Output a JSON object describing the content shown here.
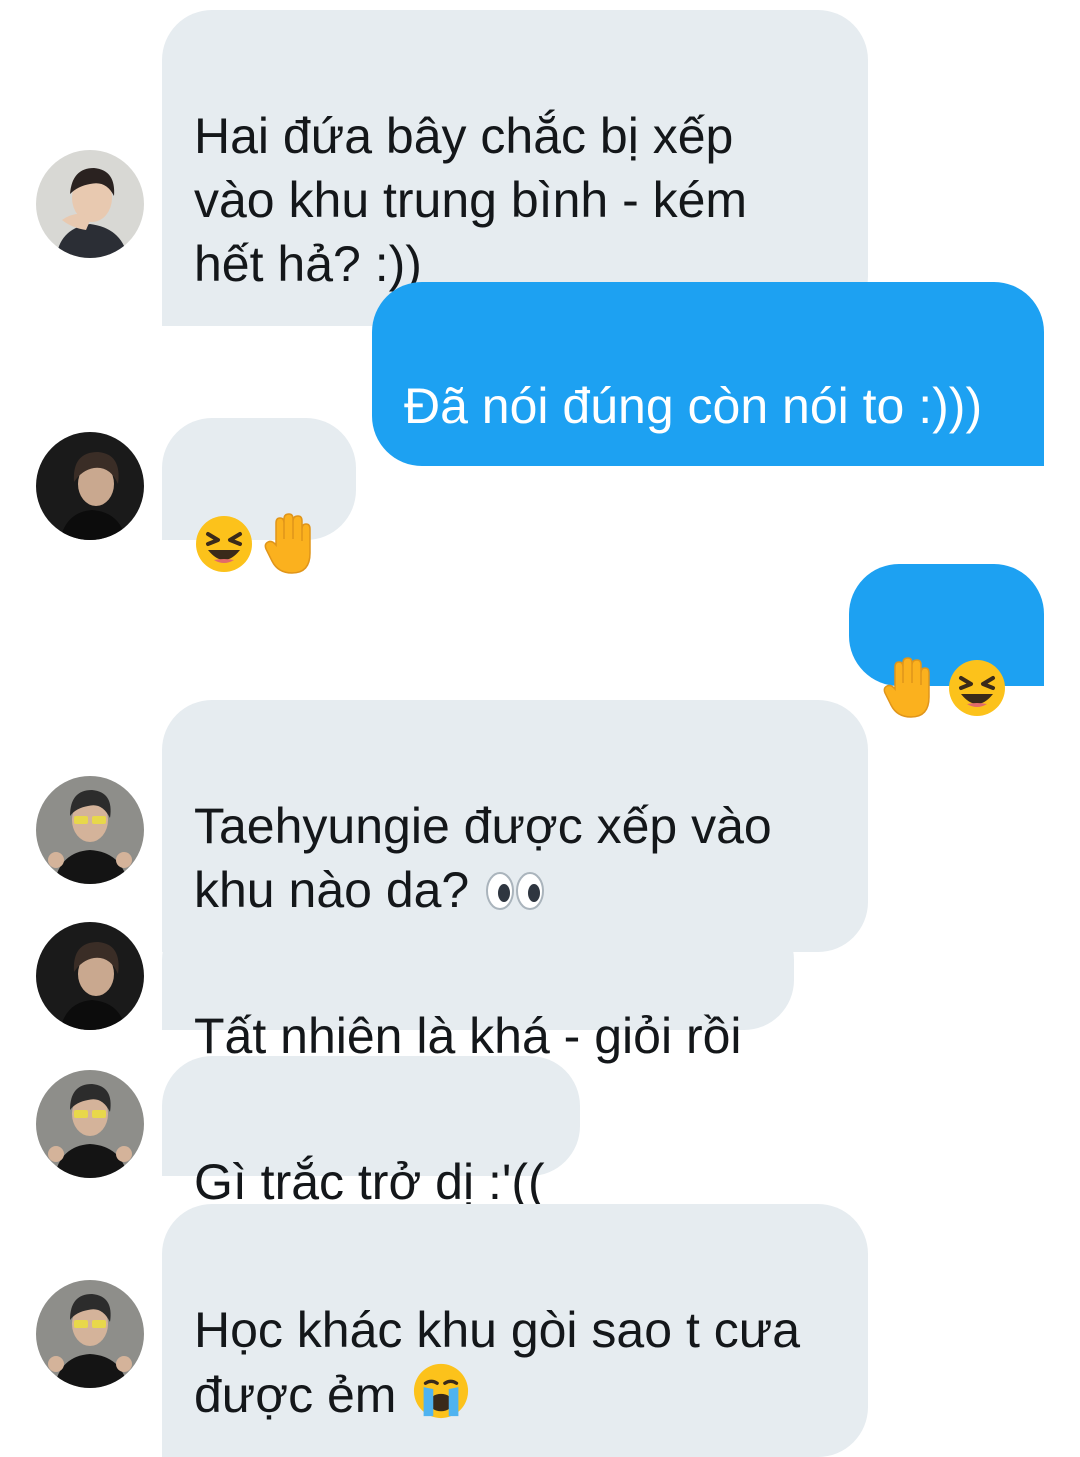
{
  "conversation": {
    "messages": [
      {
        "side": "in",
        "avatar": "avatar-boy-a",
        "text": "Hai đứa bây chắc bị xếp\nvào khu trung bình - kém\nhết hả? :))"
      },
      {
        "side": "out",
        "text": "Đã nói đúng còn nói to :)))"
      },
      {
        "side": "in",
        "avatar": "avatar-boy-b",
        "emojis": [
          "laughing-face",
          "raised-hand"
        ]
      },
      {
        "side": "out",
        "emojis": [
          "raised-hand",
          "laughing-face"
        ]
      },
      {
        "side": "in",
        "avatar": "avatar-boy-c",
        "text": "Taehyungie được xếp vào\nkhu nào dạ?",
        "trailing_emoji": "eyes"
      },
      {
        "side": "in",
        "avatar": "avatar-boy-b",
        "text": "Tất nhiên là khá - giỏi rồi"
      },
      {
        "side": "in",
        "avatar": "avatar-boy-c",
        "text": "Gì trắc trở dị :'(("
      },
      {
        "side": "in",
        "avatar": "avatar-boy-c",
        "text": "Học khác khu gòi sao t cưa\nđược ẻm",
        "trailing_emoji": "crying-face"
      }
    ]
  },
  "colors": {
    "incoming_bubble": "#e6ecf0",
    "outgoing_bubble": "#1da1f2",
    "text_dark": "#14171a",
    "text_light": "#ffffff"
  }
}
